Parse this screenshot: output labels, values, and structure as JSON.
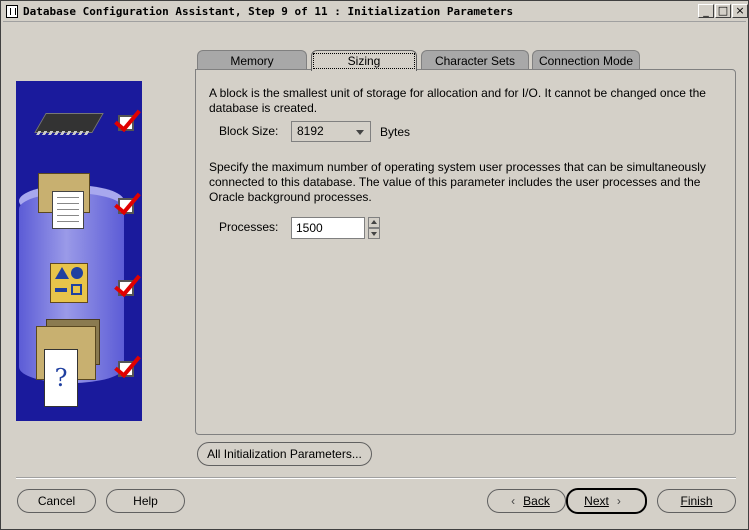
{
  "window": {
    "title": "Database Configuration Assistant, Step 9 of 11 : Initialization Parameters",
    "controls": {
      "minimize": "_",
      "maximize": "□",
      "close": "×"
    }
  },
  "tabs": [
    {
      "label": "Memory"
    },
    {
      "label": "Sizing",
      "active": true
    },
    {
      "label": "Character Sets"
    },
    {
      "label": "Connection Mode"
    }
  ],
  "sizing": {
    "block_desc": "A block is the smallest unit of storage for allocation and for I/O. It cannot be changed once the database is created.",
    "block_label": "Block Size:",
    "block_value": "8192",
    "block_unit": "Bytes",
    "proc_desc": "Specify the maximum number of operating system user processes that can be simultaneously connected to this database. The value of this parameter includes the user processes and the Oracle background processes.",
    "proc_label": "Processes:",
    "proc_value": "1500"
  },
  "all_params_button": "All Initialization Parameters...",
  "buttons": {
    "cancel": "Cancel",
    "help": "Help",
    "back": "Back",
    "next": "Next",
    "finish": "Finish"
  },
  "side_art": {
    "icons": [
      "memory-chip-icon",
      "documents-folder-icon",
      "shapes-icon",
      "help-documents-icon"
    ],
    "steps_checked": [
      true,
      true,
      true,
      true
    ],
    "colors": {
      "background": "#1a1a9c",
      "check": "#e00000"
    }
  }
}
